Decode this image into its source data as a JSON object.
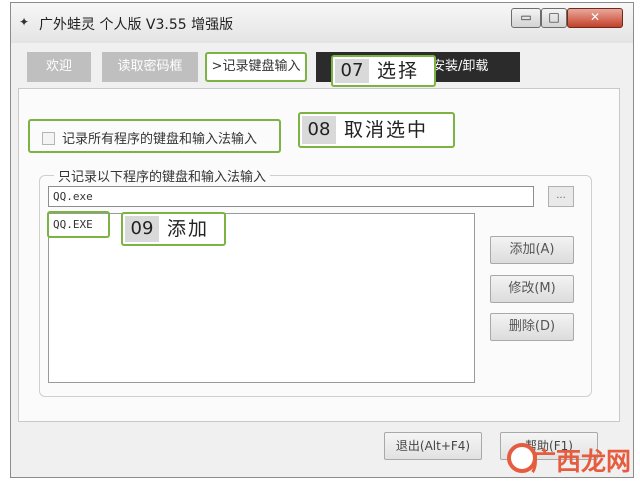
{
  "window": {
    "title": "广外蛙灵 个人版 V3.55 增强版",
    "minimize": "▭",
    "maximize": "□",
    "close": "✕"
  },
  "tabs": [
    {
      "label": "欢迎"
    },
    {
      "label": "读取密码框"
    },
    {
      "label": ">记录键盘输入"
    },
    {
      "label": "安装/卸载"
    }
  ],
  "callouts": [
    {
      "number": "07",
      "text": "选择"
    },
    {
      "number": "08",
      "text": "取消选中"
    },
    {
      "number": "09",
      "text": "添加"
    }
  ],
  "record_all": {
    "label": "记录所有程序的键盘和输入法输入",
    "checked": false
  },
  "group": {
    "legend": "只记录以下程序的键盘和输入法输入",
    "path_value": "QQ.exe",
    "browse_label": "...",
    "list_items": [
      "QQ.EXE"
    ]
  },
  "side_buttons": {
    "add": "添加(A)",
    "edit": "修改(M)",
    "delete": "删除(D)"
  },
  "bottom_buttons": {
    "exit": "退出(Alt+F4)",
    "help": "帮助(F1)"
  },
  "watermark": {
    "text": "广西龙网"
  },
  "colors": {
    "highlight_green": "#7cb342",
    "tab_gray": "#bfbfbf",
    "tab_dark": "#2b2b2b",
    "watermark_red": "#e65c3f"
  }
}
